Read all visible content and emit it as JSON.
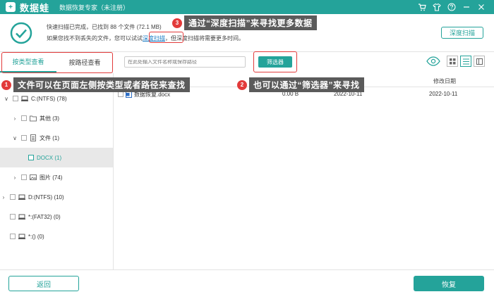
{
  "titlebar": {
    "logo_glyph": "+",
    "brand": "数据蛙",
    "edition": "数据恢复专家（未注册）",
    "icons": [
      "cart-icon",
      "shirt-icon",
      "help-icon",
      "minimize-icon",
      "close-icon"
    ]
  },
  "summary": {
    "line1": "快速扫描已完成，已找到 88 个文件 (72.1 MB)",
    "line2_before": "如果您找不到丢失的文件，您可以试试",
    "line2_link": "深度扫描",
    "line2_after": "，但深度扫描将需要更多时间。",
    "deep_scan_button": "深度扫描"
  },
  "tabs": [
    {
      "label": "按类型查看",
      "active": true
    },
    {
      "label": "按路径查看",
      "active": false
    }
  ],
  "search": {
    "placeholder": "在此处输入文件名称或保存路径"
  },
  "filter_button": "筛选器",
  "tree": [
    {
      "label": "C:(NTFS) (78)",
      "caret": "∨",
      "icon": "drive-icon"
    },
    {
      "label": "其他 (3)",
      "caret": "›",
      "icon": "folder-icon"
    },
    {
      "label": "文件 (1)",
      "caret": "∨",
      "icon": "document-icon"
    },
    {
      "label": "DOCX (1)",
      "caret": "",
      "icon": "none",
      "selected": true
    },
    {
      "label": "图片 (74)",
      "caret": "›",
      "icon": "image-icon"
    },
    {
      "label": "D:(NTFS) (10)",
      "caret": "›",
      "icon": "drive-icon"
    },
    {
      "label": "*:(FAT32) (0)",
      "caret": "",
      "icon": "drive-icon"
    },
    {
      "label": "*:() (0)",
      "caret": "",
      "icon": "drive-icon"
    }
  ],
  "table": {
    "modified_header": "修改日期",
    "rows": [
      {
        "name": "数据恢复.docx",
        "size": "0.00 B",
        "created": "2022-10-11",
        "modified": "2022-10-11"
      }
    ]
  },
  "footer": {
    "back": "返回",
    "recover": "恢复"
  },
  "callouts": [
    {
      "num": "1",
      "text": "文件可以在页面左侧按类型或者路径来查找"
    },
    {
      "num": "2",
      "text": "也可以通过“筛选器”来寻找"
    },
    {
      "num": "3",
      "text": "通过“深度扫描”来寻找更多数据"
    }
  ],
  "colors": {
    "accent": "#24a39a",
    "annotation_red": "#e23b3b",
    "callout_bg": "#5b5b5b"
  }
}
